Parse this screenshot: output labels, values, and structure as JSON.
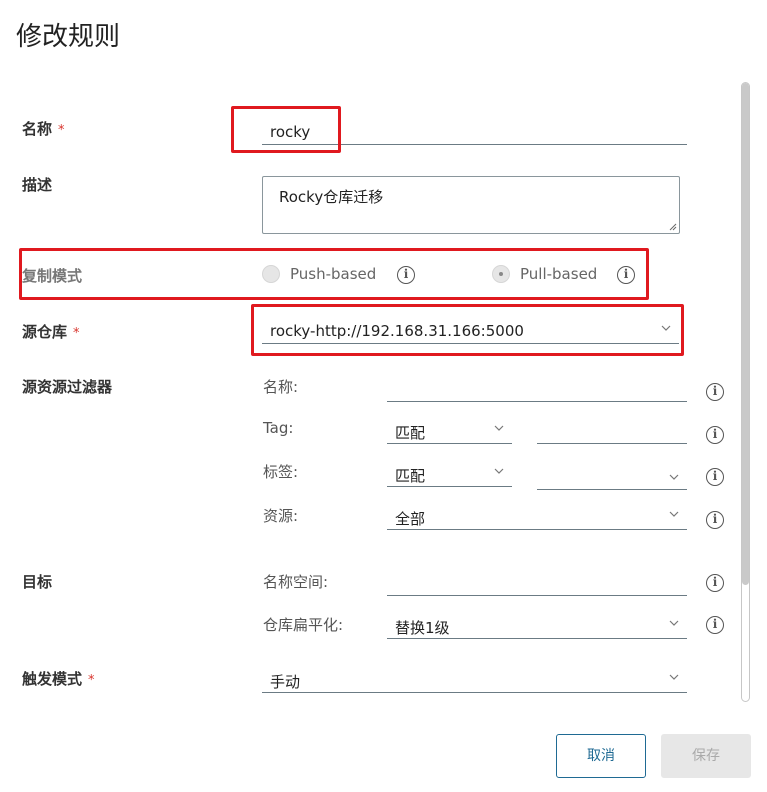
{
  "dialog": {
    "title": "修改规则"
  },
  "form": {
    "name": {
      "label": "名称",
      "required_mark": "*",
      "value": "rocky"
    },
    "description": {
      "label": "描述",
      "value": "Rocky仓库迁移"
    },
    "replication_mode": {
      "label": "复制模式",
      "options": [
        {
          "label": "Push-based",
          "selected": false
        },
        {
          "label": "Pull-based",
          "selected": true
        }
      ]
    },
    "source_registry": {
      "label": "源仓库",
      "required_mark": "*",
      "value": "rocky-http://192.168.31.166:5000"
    },
    "source_filter": {
      "label": "源资源过滤器",
      "name_label": "名称:",
      "name_value": "",
      "tag_label": "Tag:",
      "tag_match": "匹配",
      "tag_value": "",
      "labels_label": "标签:",
      "labels_match": "匹配",
      "labels_value": "",
      "resource_label": "资源:",
      "resource_value": "全部"
    },
    "destination": {
      "label": "目标",
      "namespace_label": "名称空间:",
      "namespace_value": "",
      "flatten_label": "仓库扁平化:",
      "flatten_value": "替换1级"
    },
    "trigger_mode": {
      "label": "触发模式",
      "required_mark": "*",
      "value": "手动"
    }
  },
  "footer": {
    "cancel_label": "取消",
    "save_label": "保存"
  },
  "colors": {
    "highlight": "#e0191f",
    "primary": "#1f6a93",
    "required": "#d8342c"
  },
  "icons": {
    "info": "info-icon",
    "chevron": "chevron-down-icon"
  }
}
